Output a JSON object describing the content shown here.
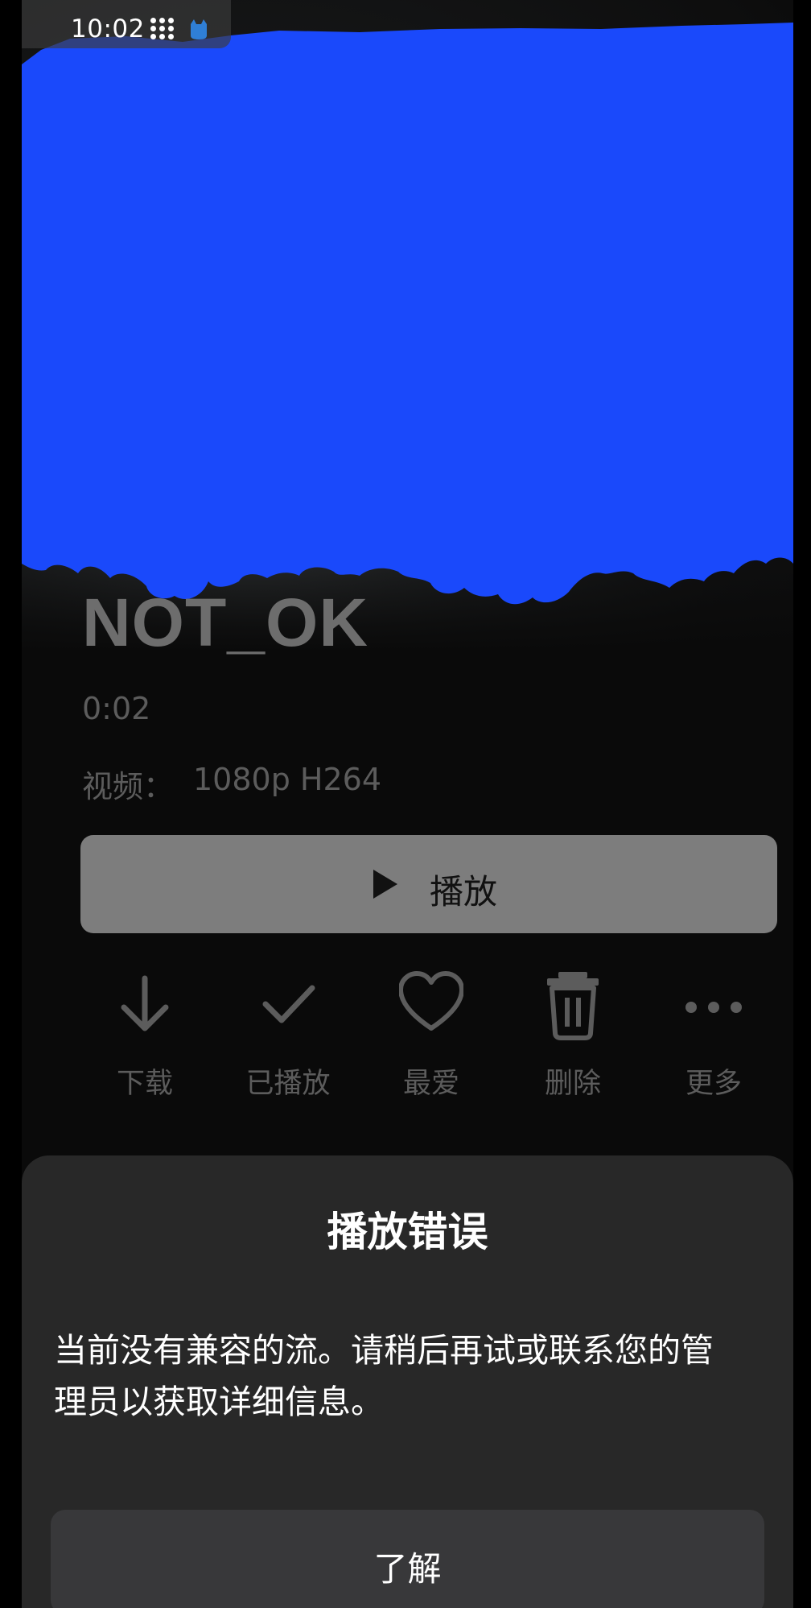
{
  "status_bar": {
    "time": "10:02"
  },
  "media": {
    "title": "NOT_OK",
    "duration": "0:02",
    "video_label": "视频：",
    "video_value": "1080p H264",
    "play_label": "播放"
  },
  "actions": [
    {
      "icon": "download-icon",
      "label": "下载"
    },
    {
      "icon": "checkmark-icon",
      "label": "已播放"
    },
    {
      "icon": "heart-icon",
      "label": "最爱"
    },
    {
      "icon": "trash-icon",
      "label": "删除"
    },
    {
      "icon": "more-icon",
      "label": "更多"
    }
  ],
  "dialog": {
    "title": "播放错误",
    "message": "当前没有兼容的流。请稍后再试或联系您的管理员以获取详细信息。",
    "button_label": "了解"
  },
  "colors": {
    "redaction": "#1a49fb",
    "dialog_background": "#282828",
    "play_button_background": "#7d7d7d"
  }
}
